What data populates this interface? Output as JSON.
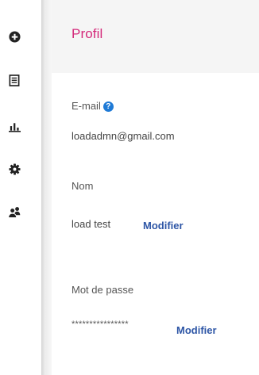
{
  "nav": {
    "items": [
      {
        "icon": "add-circle-icon"
      },
      {
        "icon": "document-icon"
      },
      {
        "icon": "bar-chart-icon"
      },
      {
        "icon": "gear-icon"
      },
      {
        "icon": "users-icon"
      }
    ]
  },
  "profile": {
    "title": "Profil",
    "email_label": "E-mail",
    "help_glyph": "?",
    "email_value": "loadadmn@gmail.com",
    "name_label": "Nom",
    "name_value": "load test",
    "name_edit": "Modifier",
    "password_label": "Mot de passe",
    "password_value": "****************",
    "password_edit": "Modifier"
  },
  "colors": {
    "title": "#d4297a",
    "link": "#2e56a6",
    "help_badge": "#1f7ad6",
    "icons": "#222222"
  }
}
